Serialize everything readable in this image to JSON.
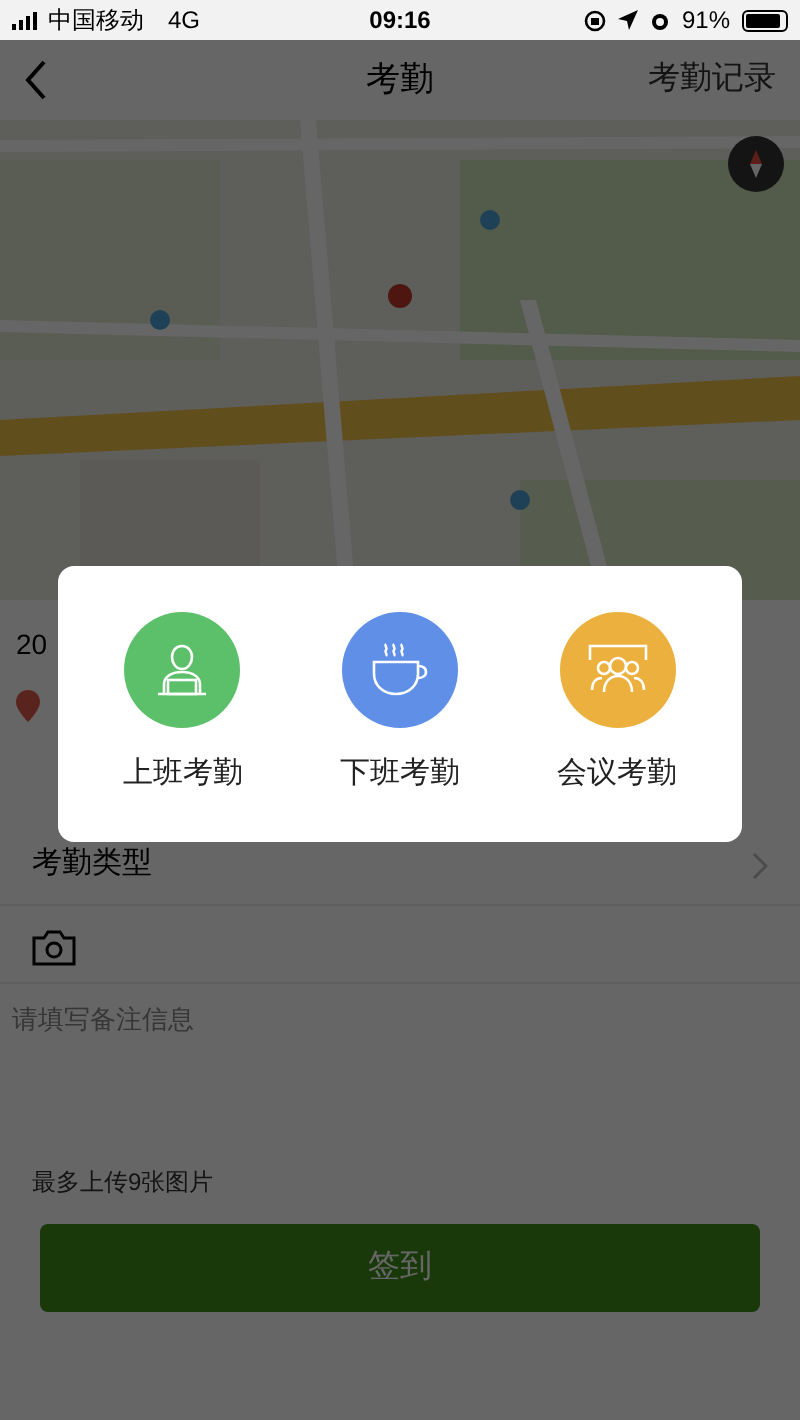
{
  "status_bar": {
    "carrier": "中国移动",
    "network": "4G",
    "time": "09:16",
    "battery": "91%"
  },
  "nav": {
    "title": "考勤",
    "action": "考勤记录"
  },
  "location": {
    "text": "20"
  },
  "type_row": {
    "label": "考勤类型"
  },
  "remark": {
    "placeholder": "请填写备注信息"
  },
  "upload_hint": "最多上传9张图片",
  "submit": "签到",
  "dialog": {
    "options": [
      {
        "kind": "work_start",
        "label": "上班考勤",
        "color": "#5cbf69"
      },
      {
        "kind": "work_end",
        "label": "下班考勤",
        "color": "#5f8fe6"
      },
      {
        "kind": "meeting",
        "label": "会议考勤",
        "color": "#ecb03e"
      }
    ]
  }
}
